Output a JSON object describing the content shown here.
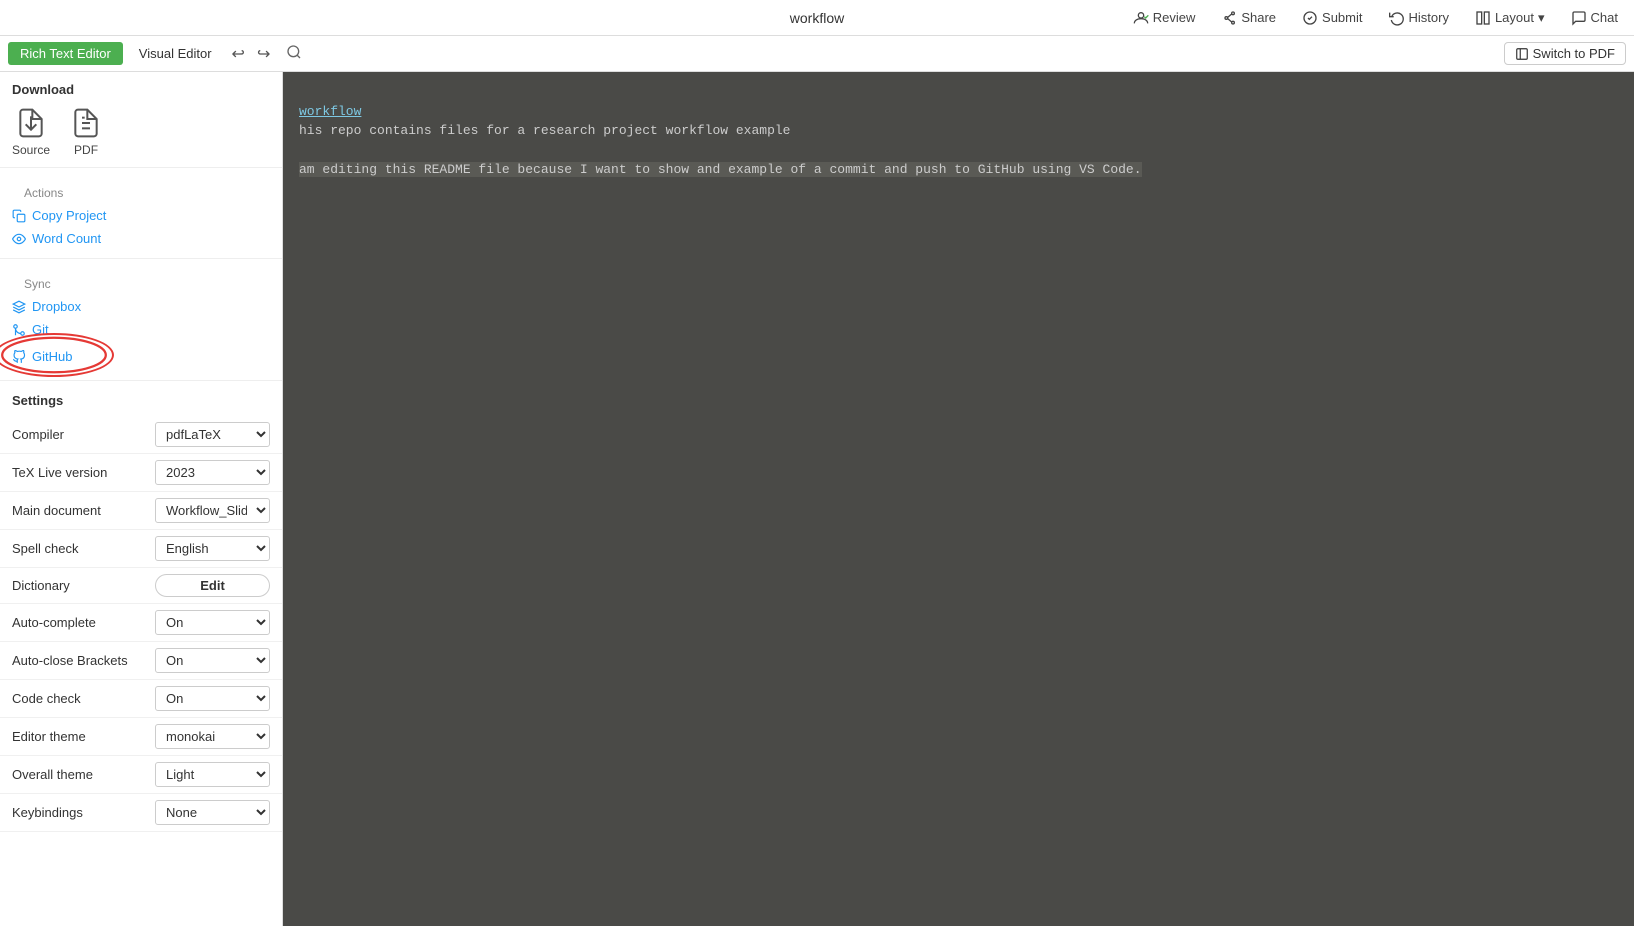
{
  "topbar": {
    "title": "workflow",
    "review_label": "Review",
    "share_label": "Share",
    "submit_label": "Submit",
    "history_label": "History",
    "layout_label": "Layout",
    "chat_label": "Chat"
  },
  "editor_toolbar": {
    "rich_text_label": "Rich Text Editor",
    "visual_label": "Visual Editor",
    "switch_pdf_label": "Switch to PDF"
  },
  "sidebar": {
    "download_title": "Download",
    "source_label": "Source",
    "pdf_label": "PDF",
    "actions_title": "Actions",
    "copy_project_label": "Copy Project",
    "word_count_label": "Word Count",
    "sync_title": "Sync",
    "dropbox_label": "Dropbox",
    "git_label": "Git",
    "github_label": "GitHub",
    "settings_title": "Settings",
    "compiler_label": "Compiler",
    "compiler_value": "pdfLaTeX",
    "texlive_label": "TeX Live version",
    "texlive_value": "2023",
    "main_doc_label": "Main document",
    "main_doc_value": "Workflow_Slides/",
    "spellcheck_label": "Spell check",
    "spellcheck_value": "English",
    "dictionary_label": "Dictionary",
    "dictionary_btn": "Edit",
    "autocomplete_label": "Auto-complete",
    "autocomplete_value": "On",
    "autoclose_label": "Auto-close Brackets",
    "autoclose_value": "On",
    "codecheck_label": "Code check",
    "codecheck_value": "On",
    "editor_theme_label": "Editor theme",
    "editor_theme_value": "monokai",
    "overall_theme_label": "Overall theme",
    "overall_theme_value": "Light",
    "keybindings_label": "Keybindings",
    "keybindings_value": "None"
  },
  "editor": {
    "filename": "workflow",
    "line1": "his repo contains files for a research project workflow example",
    "line2": "",
    "line3": "am editing this README file because I want to show and example of a commit and push to GitHub using VS Code."
  },
  "colors": {
    "accent_green": "#4caf50",
    "link_blue": "#2196f3",
    "editor_bg": "#4a4a47",
    "circle_red": "#e53935"
  }
}
